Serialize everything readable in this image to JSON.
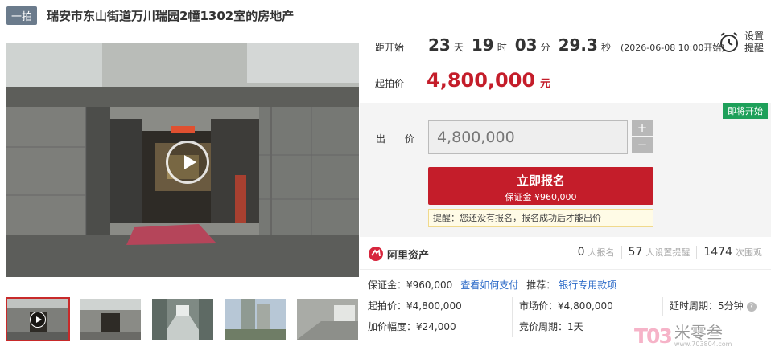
{
  "header": {
    "badge": "一拍",
    "title": "瑞安市东山街道万川瑞园2幢1302室的房地产"
  },
  "countdown": {
    "label": "距开始",
    "days": "23",
    "days_unit": "天",
    "hours": "19",
    "hours_unit": "时",
    "minutes": "03",
    "minutes_unit": "分",
    "seconds": "29.3",
    "seconds_unit": "秒",
    "start_time": "(2026-06-08 10:00开始)"
  },
  "remind": {
    "label": "设置提醒",
    "icon": "alarm-clock-icon"
  },
  "start_price": {
    "label": "起拍价",
    "value": "4,800,000",
    "unit": "元"
  },
  "bid": {
    "status": "即将开始",
    "label": "出 价",
    "value": "4,800,000",
    "plus": "+",
    "minus": "−",
    "apply_label": "立即报名",
    "deposit_label": "保证金 ¥960,000",
    "tip": "提醒：您还没有报名，报名成功后才能出价"
  },
  "org": {
    "name": "阿里资产",
    "stats": [
      {
        "num": "0",
        "text": "人报名"
      },
      {
        "num": "57",
        "text": "人设置提醒"
      },
      {
        "num": "1474",
        "text": "次围观"
      }
    ]
  },
  "deposit": {
    "label": "保证金：¥960,000",
    "how_link": "查看如何支付",
    "recommend_label": "推荐：",
    "recommend_link": "银行专用款项"
  },
  "info": {
    "start_price": "起拍价：¥4,800,000",
    "increment": "加价幅度：¥24,000",
    "market_price": "市场价：¥4,800,000",
    "bid_period": "竞价周期：1天",
    "delay_period": "延时周期：5分钟",
    "help": "?"
  },
  "watermark": {
    "logo": "T03",
    "name": "米零叁",
    "url": "www.703804.com"
  },
  "colors": {
    "accent": "#c41d2a",
    "status": "#1ea05a",
    "link": "#2d6bc8"
  }
}
